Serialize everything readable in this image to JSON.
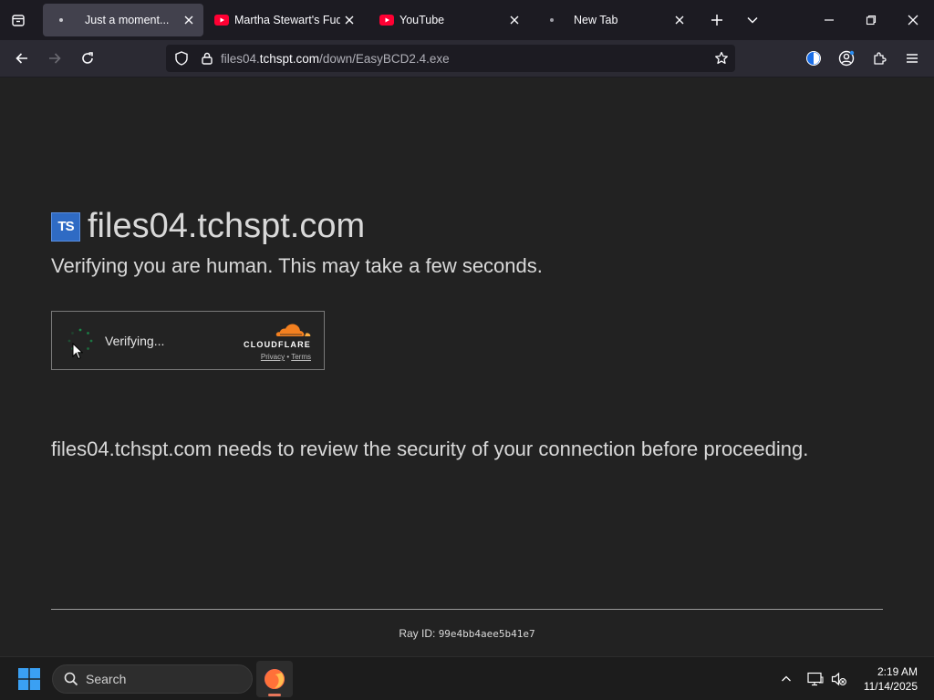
{
  "browser": {
    "tabs": [
      {
        "title": "Just a moment...",
        "active": true,
        "favicon": "loading-dot-icon"
      },
      {
        "title": "Martha Stewart's Fudgy",
        "active": false,
        "favicon": "youtube-icon"
      },
      {
        "title": "YouTube",
        "active": false,
        "favicon": "youtube-icon"
      },
      {
        "title": "New Tab",
        "active": false,
        "favicon": "dot-icon"
      }
    ],
    "url": {
      "prefix": "files04.",
      "host": "tchspt.com",
      "path": "/down/EasyBCD2.4.exe"
    }
  },
  "page": {
    "site_logo_text": "TS",
    "site_title": "files04.tchspt.com",
    "verify_message": "Verifying you are human. This may take a few seconds.",
    "widget": {
      "status": "Verifying...",
      "brand": "CLOUDFLARE",
      "privacy": "Privacy",
      "separator": "•",
      "terms": "Terms"
    },
    "security_message": "files04.tchspt.com needs to review the security of your connection before proceeding.",
    "ray_label": "Ray ID:",
    "ray_id": "99e4bb4aee5b41e7"
  },
  "taskbar": {
    "search_label": "Search",
    "time": "2:19 AM",
    "date": "11/14/2025"
  },
  "colors": {
    "accent_youtube": "#ff0033",
    "cloudflare_orange": "#f38020",
    "page_bg": "#222222"
  }
}
